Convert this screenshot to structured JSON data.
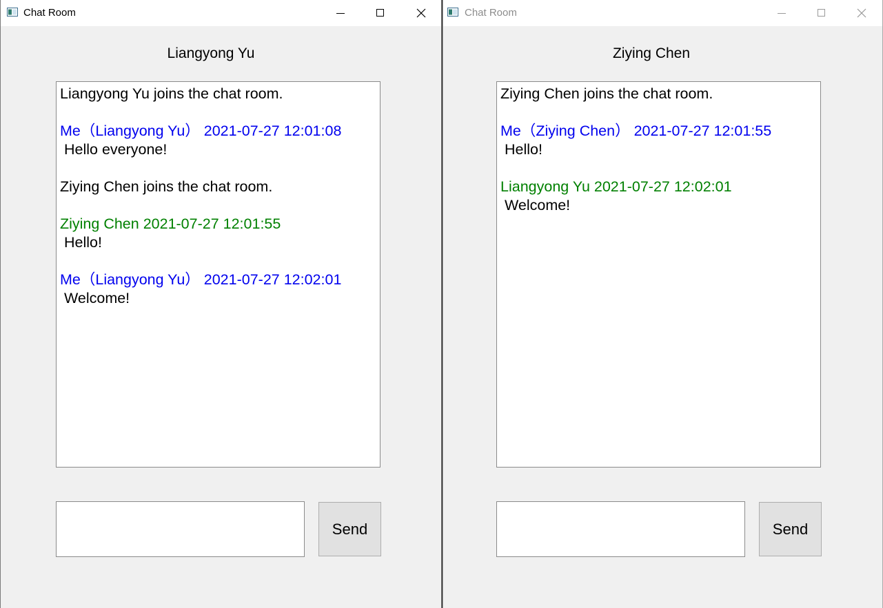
{
  "windows": [
    {
      "title": "Chat Room",
      "active": true,
      "user": "Liangyong Yu",
      "messages": [
        {
          "kind": "system",
          "lines": [
            "Liangyong Yu joins the chat room."
          ]
        },
        {
          "kind": "self",
          "lines": [
            "Me（Liangyong Yu） 2021-07-27 12:01:08",
            " Hello everyone!"
          ]
        },
        {
          "kind": "system",
          "lines": [
            "Ziying Chen joins the chat room."
          ]
        },
        {
          "kind": "other",
          "lines": [
            "Ziying Chen 2021-07-27 12:01:55",
            " Hello!"
          ]
        },
        {
          "kind": "self",
          "lines": [
            "Me（Liangyong Yu） 2021-07-27 12:02:01",
            " Welcome!"
          ]
        }
      ],
      "input_value": "",
      "send_label": "Send"
    },
    {
      "title": "Chat Room",
      "active": false,
      "user": "Ziying Chen",
      "messages": [
        {
          "kind": "system",
          "lines": [
            "Ziying Chen joins the chat room."
          ]
        },
        {
          "kind": "self",
          "lines": [
            "Me（Ziying Chen） 2021-07-27 12:01:55",
            " Hello!"
          ]
        },
        {
          "kind": "other",
          "lines": [
            "Liangyong Yu 2021-07-27 12:02:01",
            " Welcome!"
          ]
        }
      ],
      "input_value": "",
      "send_label": "Send"
    }
  ],
  "icons": {
    "app": "app-window-icon",
    "minimize": "minimize-icon",
    "maximize": "maximize-icon",
    "close": "close-icon"
  },
  "colors": {
    "self_header": "#0000ee",
    "other_header": "#008000",
    "system_text": "#000000",
    "window_bg": "#f0f0f0",
    "button_bg": "#e1e1e1"
  }
}
